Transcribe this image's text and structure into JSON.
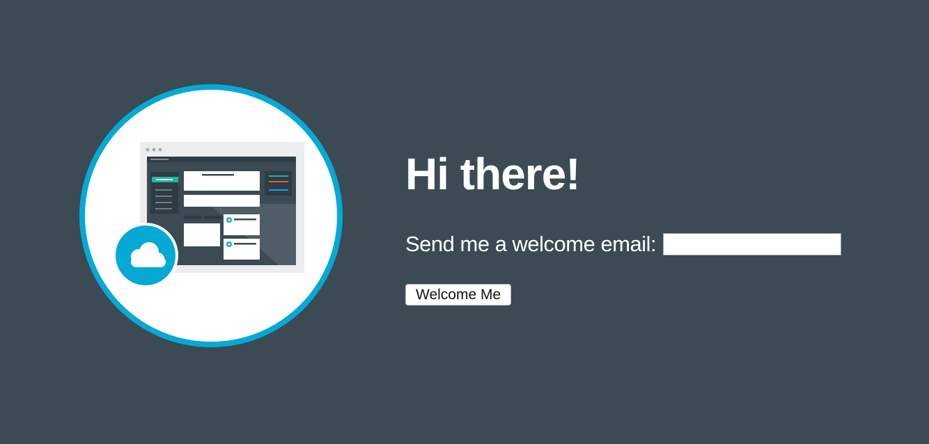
{
  "hero": {
    "illustration_icon": "cloud-dashboard-illustration",
    "badge_icon": "cloud-icon",
    "ring_color": "#06a9d6"
  },
  "main": {
    "title": "Hi there!",
    "email_label": "Send me a welcome email:",
    "email_value": "",
    "email_placeholder": "",
    "button_label": "Welcome Me"
  },
  "colors": {
    "background": "#3b4a53",
    "text": "#ffffff",
    "accent_teal": "#1fb79e",
    "accent_red": "#e25b4a",
    "accent_blue": "#06a9d6"
  }
}
